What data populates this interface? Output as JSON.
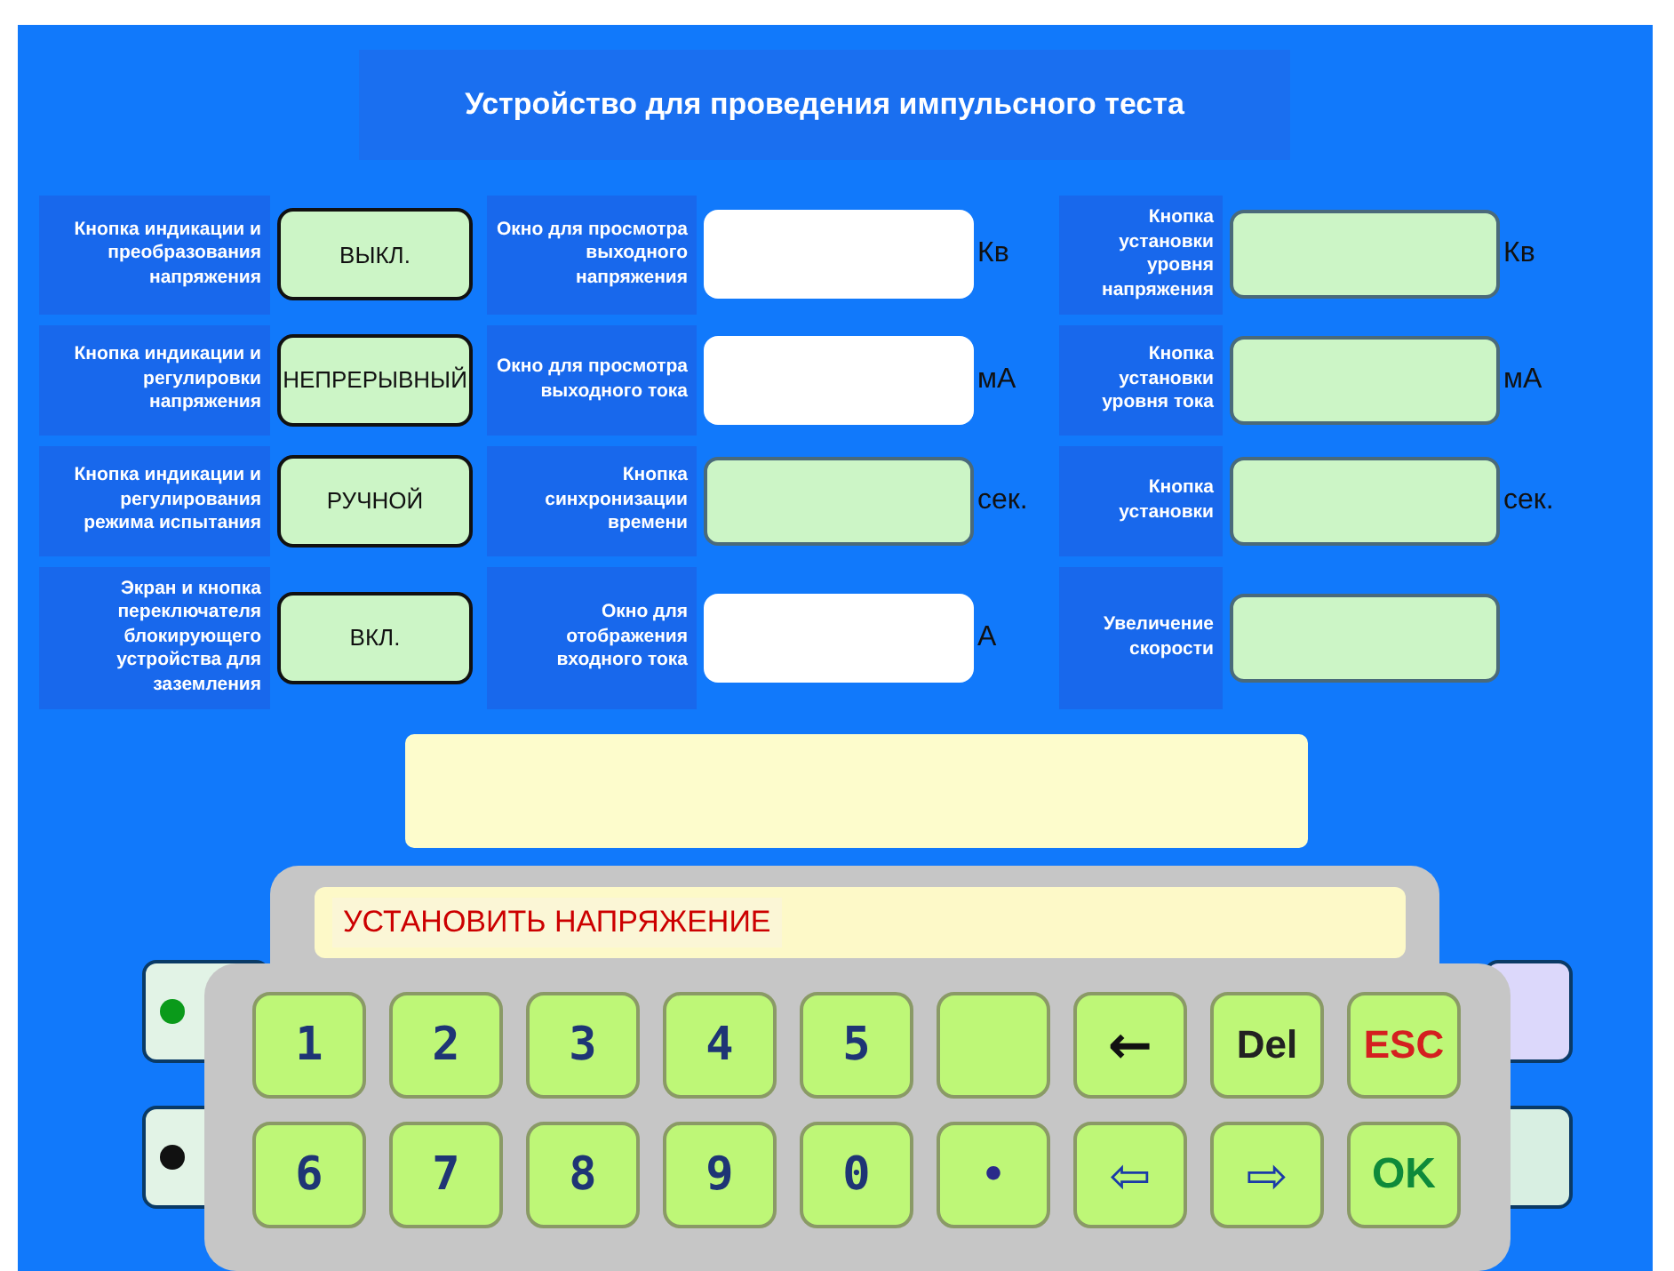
{
  "title": "Устройство для проведения импульсного теста",
  "rows": [
    {
      "left": {
        "label": "Кнопка индикации и преобразования напряжения",
        "button": "ВЫКЛ."
      },
      "middle": {
        "label": "Окно для просмотра выходного напряжения",
        "kind": "display",
        "unit": "Кв"
      },
      "right": {
        "label": "Кнопка установки уровня напряжения",
        "unit": "Кв"
      }
    },
    {
      "left": {
        "label": "Кнопка индикации и регулировки напряжения",
        "button": "НЕПРЕРЫВНЫЙ"
      },
      "middle": {
        "label": "Окно для просмотра выходного тока",
        "kind": "display",
        "unit": "мА"
      },
      "right": {
        "label": "Кнопка установки уровня тока",
        "unit": "мА"
      }
    },
    {
      "left": {
        "label": "Кнопка индикации и регулирования режима испытания",
        "button": "РУЧНОЙ"
      },
      "middle": {
        "label": "Кнопка синхронизации времени",
        "kind": "button",
        "unit": "сек."
      },
      "right": {
        "label": "Кнопка установки",
        "unit": "сек."
      }
    },
    {
      "left": {
        "label": "Экран и кнопка переключателя блокирующего устройства для заземления",
        "button": "ВКЛ."
      },
      "middle": {
        "label": "Окно для отображения входного тока",
        "kind": "display",
        "unit": "А"
      },
      "right": {
        "label": "Увеличение скорости"
      }
    }
  ],
  "indicators": [
    {
      "color": "#0a9a1a"
    },
    {
      "color": "#111111"
    }
  ],
  "keypad": {
    "prompt": "УСТАНОВИТЬ НАПРЯЖЕНИЕ",
    "keys": [
      {
        "kind": "digit",
        "label": "1"
      },
      {
        "kind": "digit",
        "label": "2"
      },
      {
        "kind": "digit",
        "label": "3"
      },
      {
        "kind": "digit",
        "label": "4"
      },
      {
        "kind": "digit",
        "label": "5"
      },
      {
        "kind": "blank"
      },
      {
        "kind": "arrow",
        "label": "←"
      },
      {
        "kind": "del",
        "label": "Del"
      },
      {
        "kind": "esc",
        "label": "ESC"
      },
      {
        "kind": "digit",
        "label": "6"
      },
      {
        "kind": "digit",
        "label": "7"
      },
      {
        "kind": "digit",
        "label": "8"
      },
      {
        "kind": "digit",
        "label": "9"
      },
      {
        "kind": "digit",
        "label": "0"
      },
      {
        "kind": "dot",
        "label": "•"
      },
      {
        "kind": "nav",
        "label": "⇦"
      },
      {
        "kind": "nav",
        "label": "⇨"
      },
      {
        "kind": "ok",
        "label": "OK"
      }
    ]
  }
}
